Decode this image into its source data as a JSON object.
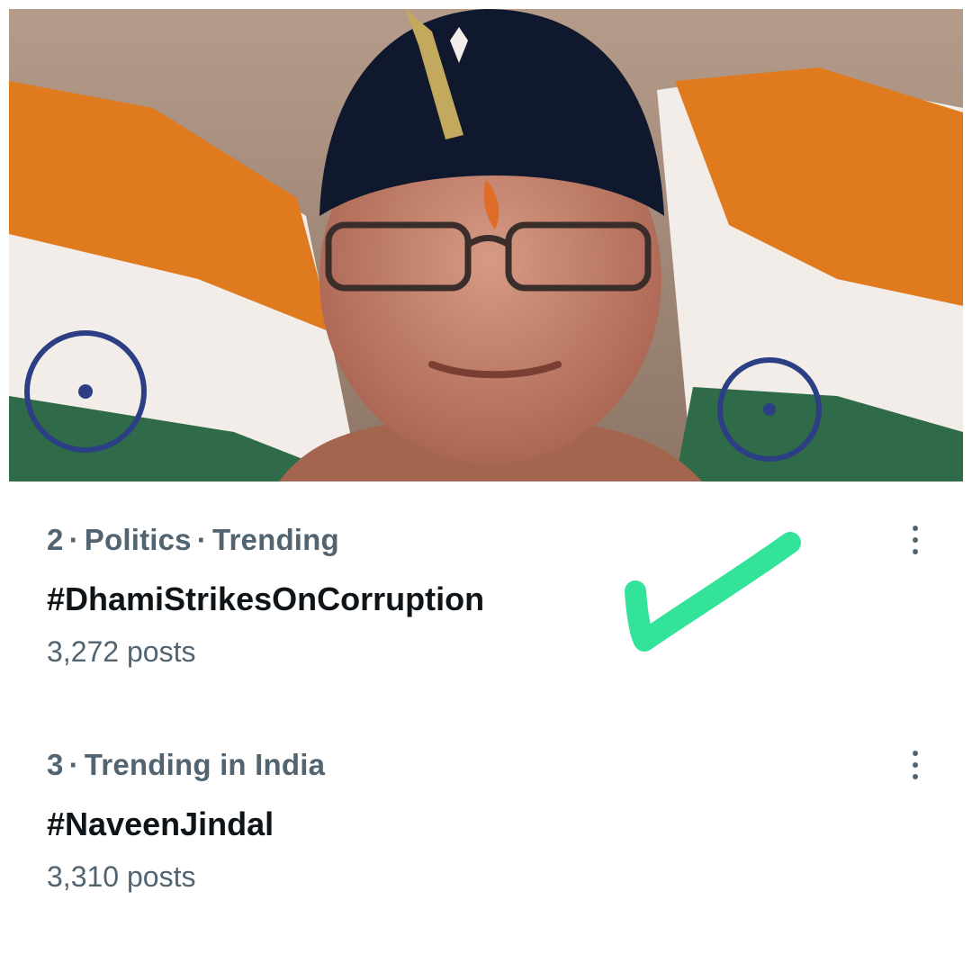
{
  "hero_image": {
    "subject": "Photo of a man wearing a black cap with a decorated band and glasses, Indian flags in background",
    "colors": {
      "saffron": "#e07a1f",
      "white": "#f2ede8",
      "green": "#2f6b48",
      "chakra": "#2d3f84",
      "cap": "#10182d"
    }
  },
  "trends": [
    {
      "rank": "2",
      "category": "Politics",
      "status": "Trending",
      "hashtag": "#DhamiStrikesOnCorruption",
      "posts": "3,272 posts"
    },
    {
      "rank": "3",
      "category": "Trending in India",
      "hashtag": "#NaveenJindal",
      "posts": "3,310 posts"
    }
  ],
  "separator": "·",
  "icons": {
    "more": "more-options-icon",
    "check": "checkmark-icon"
  },
  "accent": {
    "checkmark": "#33e39a",
    "meta_text": "#536471",
    "primary_text": "#0f1419"
  }
}
